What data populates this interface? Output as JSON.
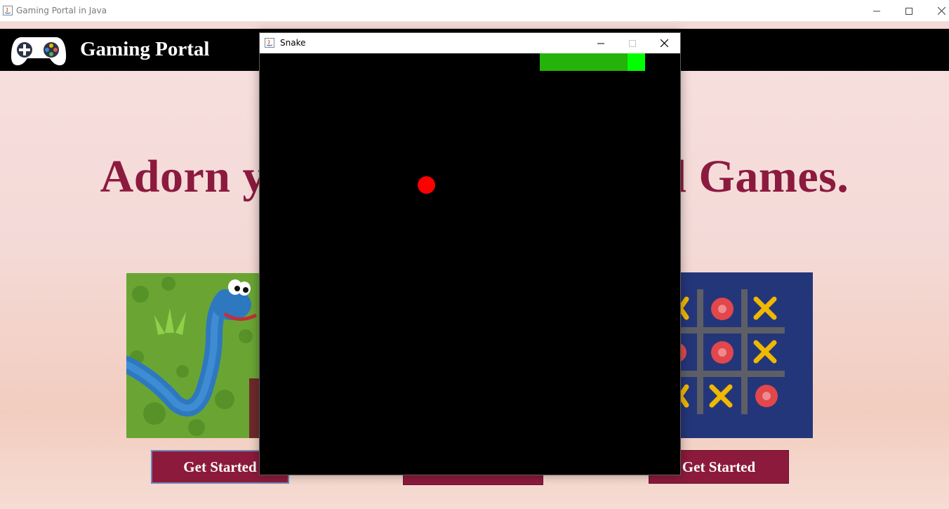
{
  "window": {
    "title": "Gaming Portal in Java"
  },
  "header": {
    "brand": "Gaming Portal"
  },
  "hero": {
    "headline": "Adorn yo                              ul Games."
  },
  "cards": [
    {
      "button_label": "Get Started"
    },
    {
      "button_label": ""
    },
    {
      "button_label": "Get Started"
    }
  ],
  "dialog": {
    "title": "Snake"
  },
  "colors": {
    "header_bg": "#000000",
    "headline": "#8c1a3f",
    "button_bg": "#8b1a3c",
    "snake_body": "#25b20a",
    "snake_head": "#00ff00",
    "apple": "#ff0000",
    "board_bg": "#000000"
  },
  "icons": [
    "java-app-icon",
    "minimize-icon",
    "maximize-icon",
    "close-icon",
    "gamepad-logo-icon"
  ]
}
